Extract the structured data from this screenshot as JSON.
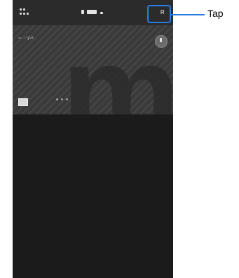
{
  "header": {
    "menu_icon": "grid-menu-icon",
    "status_icons": "status-icons",
    "top_action_icon": "share-icon",
    "top_action_text": "ᴿ"
  },
  "hero": {
    "label": "~ ·⁻/·ᵉ",
    "bottom_text": "▪ ▪ ▪",
    "decorative_letter": "m"
  },
  "annotation": {
    "callout_label": "Tap",
    "accent_color": "#2a7de1"
  }
}
